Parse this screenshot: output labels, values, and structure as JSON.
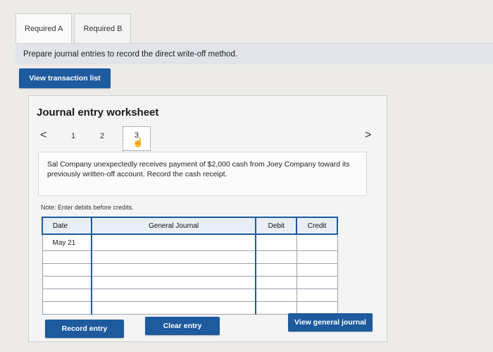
{
  "tabs": [
    {
      "label": "Required A",
      "active": true
    },
    {
      "label": "Required B",
      "active": false
    }
  ],
  "instruction": "Prepare journal entries to record the direct write-off method.",
  "view_transaction_button": "View transaction list",
  "worksheet": {
    "title": "Journal entry worksheet",
    "pager": {
      "prev": "<",
      "next": ">",
      "pages": [
        "1",
        "2",
        "3"
      ],
      "current": "3"
    },
    "transaction_text": "Sal Company unexpectedly receives payment of $2,000 cash from Joey Company toward its previously written-off account. Record the cash receipt.",
    "note": "Note: Enter debits before credits.",
    "table": {
      "headers": {
        "date": "Date",
        "general_journal": "General Journal",
        "debit": "Debit",
        "credit": "Credit"
      },
      "rows": [
        {
          "date": "May 21",
          "account": "",
          "debit": "",
          "credit": ""
        },
        {
          "date": "",
          "account": "",
          "debit": "",
          "credit": ""
        },
        {
          "date": "",
          "account": "",
          "debit": "",
          "credit": ""
        },
        {
          "date": "",
          "account": "",
          "debit": "",
          "credit": ""
        },
        {
          "date": "",
          "account": "",
          "debit": "",
          "credit": ""
        },
        {
          "date": "",
          "account": "",
          "debit": "",
          "credit": ""
        }
      ]
    }
  },
  "buttons": {
    "record_entry": "Record entry",
    "clear_entry": "Clear entry",
    "view_general_journal": "View general journal"
  },
  "colors": {
    "accent": "#1d5a9e",
    "background": "#ecebe8"
  }
}
